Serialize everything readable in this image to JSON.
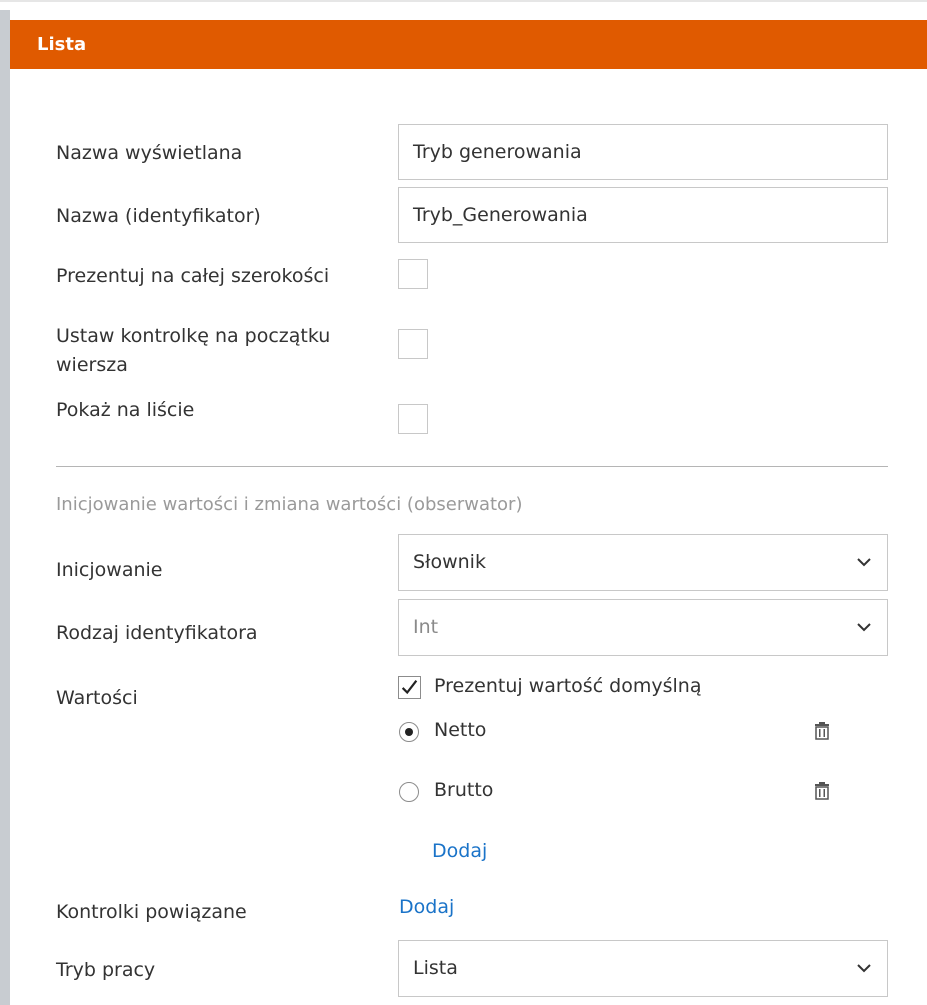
{
  "header": {
    "title": "Lista",
    "color": "#e05a00"
  },
  "fields": {
    "display_name": {
      "label": "Nazwa wyświetlana",
      "value": "Tryb generowania"
    },
    "identifier": {
      "label": "Nazwa (identyfikator)",
      "value": "Tryb_Generowania"
    },
    "full_width": {
      "label": "Prezentuj na całej szerokości",
      "checked": false
    },
    "row_start": {
      "label_line1": "Ustaw kontrolkę na początku",
      "label_line2": "wiersza",
      "checked": false
    },
    "show_on_list": {
      "label": "Pokaż na liście",
      "checked": false
    }
  },
  "section": {
    "title": "Inicjowanie wartości i zmiana wartości (obserwator)",
    "init": {
      "label": "Inicjowanie",
      "value": "Słownik"
    },
    "id_type": {
      "label": "Rodzaj identyfikatora",
      "value": "Int"
    },
    "values": {
      "label": "Wartości",
      "show_default_label": "Prezentuj wartość domyślną",
      "show_default_checked": true,
      "options": [
        {
          "label": "Netto",
          "selected": true
        },
        {
          "label": "Brutto",
          "selected": false
        }
      ],
      "add_label": "Dodaj"
    },
    "linked": {
      "label": "Kontrolki powiązane",
      "add_label": "Dodaj"
    },
    "mode": {
      "label": "Tryb pracy",
      "value": "Lista"
    }
  },
  "colors": {
    "link": "#1a73c8",
    "border": "#c8c8c8"
  }
}
